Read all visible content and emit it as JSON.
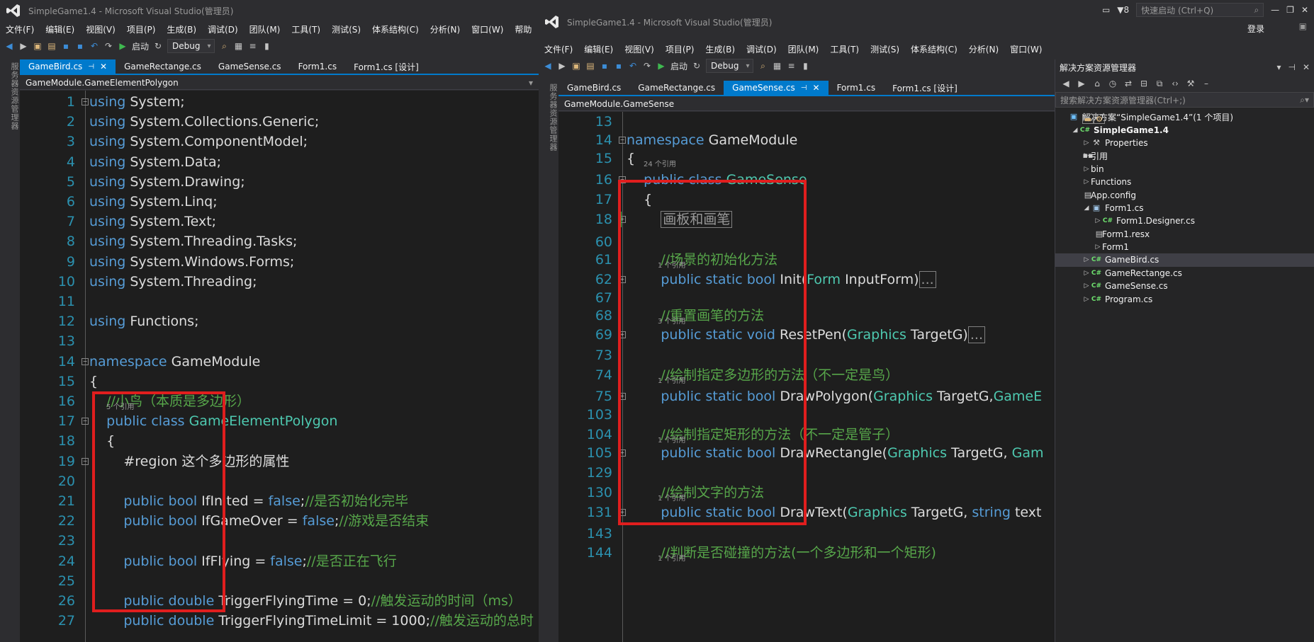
{
  "left": {
    "title": "SimpleGame1.4 - Microsoft Visual Studio(管理员)",
    "menu": [
      "文件(F)",
      "编辑(E)",
      "视图(V)",
      "项目(P)",
      "生成(B)",
      "调试(D)",
      "团队(M)",
      "工具(T)",
      "测试(S)",
      "体系结构(C)",
      "分析(N)",
      "窗口(W)",
      "帮助"
    ],
    "toolbar": {
      "start": "启动",
      "config": "Debug"
    },
    "side_label": "服务器资源管理器",
    "tabs": [
      {
        "label": "GameBird.cs",
        "active": true
      },
      {
        "label": "GameRectange.cs"
      },
      {
        "label": "GameSense.cs"
      },
      {
        "label": "Form1.cs"
      },
      {
        "label": "Form1.cs [设计]"
      }
    ],
    "nav": "GameModule.GameElementPolygon",
    "lines": [
      {
        "n": "1",
        "parts": [
          [
            "kw",
            "using"
          ],
          [
            "tx",
            " System;"
          ]
        ]
      },
      {
        "n": "2",
        "parts": [
          [
            "kw",
            "using"
          ],
          [
            "tx",
            " System.Collections.Generic;"
          ]
        ]
      },
      {
        "n": "3",
        "parts": [
          [
            "kw",
            "using"
          ],
          [
            "tx",
            " System.ComponentModel;"
          ]
        ]
      },
      {
        "n": "4",
        "parts": [
          [
            "kw",
            "using"
          ],
          [
            "tx",
            " System.Data;"
          ]
        ]
      },
      {
        "n": "5",
        "parts": [
          [
            "kw",
            "using"
          ],
          [
            "tx",
            " System.Drawing;"
          ]
        ]
      },
      {
        "n": "6",
        "parts": [
          [
            "kw",
            "using"
          ],
          [
            "tx",
            " System.Linq;"
          ]
        ]
      },
      {
        "n": "7",
        "parts": [
          [
            "kw",
            "using"
          ],
          [
            "tx",
            " System.Text;"
          ]
        ]
      },
      {
        "n": "8",
        "parts": [
          [
            "kw",
            "using"
          ],
          [
            "tx",
            " System.Threading.Tasks;"
          ]
        ]
      },
      {
        "n": "9",
        "parts": [
          [
            "kw",
            "using"
          ],
          [
            "tx",
            " System.Windows.Forms;"
          ]
        ]
      },
      {
        "n": "10",
        "parts": [
          [
            "kw",
            "using"
          ],
          [
            "tx",
            " System.Threading;"
          ]
        ]
      },
      {
        "n": "11",
        "parts": []
      },
      {
        "n": "12",
        "parts": [
          [
            "kw",
            "using"
          ],
          [
            "tx",
            " Functions;"
          ]
        ]
      },
      {
        "n": "13",
        "parts": []
      },
      {
        "n": "14",
        "parts": [
          [
            "kw",
            "namespace"
          ],
          [
            "tx",
            " GameModule"
          ]
        ]
      },
      {
        "n": "15",
        "parts": [
          [
            "tx",
            "{"
          ]
        ]
      },
      {
        "n": "16",
        "parts": [
          [
            "cm",
            "    //小鸟（本质是多边形）"
          ]
        ]
      },
      {
        "n": "17",
        "parts": [
          [
            "kw",
            "    public class "
          ],
          [
            "ty",
            "GameElementPolygon"
          ]
        ]
      },
      {
        "n": "18",
        "parts": [
          [
            "tx",
            "    {"
          ]
        ]
      },
      {
        "n": "19",
        "parts": [
          [
            "tx",
            "        #region 这个多边形的属性"
          ]
        ]
      },
      {
        "n": "20",
        "parts": []
      },
      {
        "n": "21",
        "parts": [
          [
            "kw",
            "        public bool"
          ],
          [
            "tx",
            " IfInited = "
          ],
          [
            "kw",
            "false"
          ],
          [
            "tx",
            ";"
          ],
          [
            "cm",
            "//是否初始化完毕"
          ]
        ]
      },
      {
        "n": "22",
        "parts": [
          [
            "kw",
            "        public bool"
          ],
          [
            "tx",
            " IfGameOver = "
          ],
          [
            "kw",
            "false"
          ],
          [
            "tx",
            ";"
          ],
          [
            "cm",
            "//游戏是否结束"
          ]
        ]
      },
      {
        "n": "23",
        "parts": []
      },
      {
        "n": "24",
        "parts": [
          [
            "kw",
            "        public bool"
          ],
          [
            "tx",
            " IfFlying = "
          ],
          [
            "kw",
            "false"
          ],
          [
            "tx",
            ";"
          ],
          [
            "cm",
            "//是否正在飞行"
          ]
        ]
      },
      {
        "n": "25",
        "parts": []
      },
      {
        "n": "26",
        "parts": [
          [
            "kw",
            "        public double"
          ],
          [
            "tx",
            " TriggerFlyingTime = 0;"
          ],
          [
            "cm",
            "//触发运动的时间（ms）"
          ]
        ]
      },
      {
        "n": "27",
        "parts": [
          [
            "kw",
            "        public double"
          ],
          [
            "tx",
            " TriggerFlyingTimeLimit = 1000;"
          ],
          [
            "cm",
            "//触发运动的总时"
          ]
        ]
      }
    ],
    "ref_line17": "5 个引用"
  },
  "right": {
    "title": "SimpleGame1.4 - Microsoft Visual Studio(管理员)",
    "notify_count": "8",
    "quick_launch": "快速启动 (Ctrl+Q)",
    "login": "登录",
    "menu": [
      "文件(F)",
      "编辑(E)",
      "视图(V)",
      "项目(P)",
      "生成(B)",
      "调试(D)",
      "团队(M)",
      "工具(T)",
      "测试(S)",
      "体系结构(C)",
      "分析(N)",
      "窗口(W)"
    ],
    "toolbar": {
      "start": "启动",
      "config": "Debug"
    },
    "side_label": "服务器资源管理器",
    "tabs": [
      {
        "label": "GameBird.cs"
      },
      {
        "label": "GameRectange.cs"
      },
      {
        "label": "GameSense.cs",
        "active": true
      },
      {
        "label": "Form1.cs"
      },
      {
        "label": "Form1.cs [设计]"
      }
    ],
    "nav": "GameModule.GameSense",
    "refs": {
      "r15": "24 个引用",
      "r61": "1 个引用",
      "r68": "3 个引用",
      "r74": "1 个引用",
      "r104": "1 个引用",
      "r130": "1 个引用",
      "r144": "1 个引用"
    },
    "lines": [
      {
        "n": "13",
        "parts": []
      },
      {
        "n": "14",
        "parts": [
          [
            "kw",
            "namespace"
          ],
          [
            "tx",
            " GameModule"
          ]
        ]
      },
      {
        "n": "15",
        "parts": [
          [
            "tx",
            "{"
          ]
        ]
      },
      {
        "n": "16",
        "parts": [
          [
            "kw",
            "    public class "
          ],
          [
            "ty",
            "GameSense"
          ]
        ]
      },
      {
        "n": "17",
        "parts": [
          [
            "tx",
            "    {"
          ]
        ]
      },
      {
        "n": "18",
        "parts": [
          [
            "tx",
            "        "
          ],
          [
            "box",
            "画板和画笔"
          ]
        ]
      },
      {
        "n": "60",
        "parts": []
      },
      {
        "n": "61",
        "parts": [
          [
            "cm",
            "        //场景的初始化方法"
          ]
        ]
      },
      {
        "n": "62",
        "parts": [
          [
            "kw",
            "        public static bool"
          ],
          [
            "tx",
            " Init("
          ],
          [
            "ty",
            "Form"
          ],
          [
            "tx",
            " InputForm)"
          ],
          [
            "box",
            "..."
          ]
        ]
      },
      {
        "n": "67",
        "parts": []
      },
      {
        "n": "68",
        "parts": [
          [
            "cm",
            "        //重置画笔的方法"
          ]
        ]
      },
      {
        "n": "69",
        "parts": [
          [
            "kw",
            "        public static void"
          ],
          [
            "tx",
            " ResetPen("
          ],
          [
            "ty",
            "Graphics"
          ],
          [
            "tx",
            " TargetG)"
          ],
          [
            "box",
            "..."
          ]
        ]
      },
      {
        "n": "73",
        "parts": []
      },
      {
        "n": "74",
        "parts": [
          [
            "cm",
            "        //绘制指定多边形的方法（不一定是鸟）"
          ]
        ]
      },
      {
        "n": "75",
        "parts": [
          [
            "kw",
            "        public static bool"
          ],
          [
            "tx",
            " DrawPolygon("
          ],
          [
            "ty",
            "Graphics"
          ],
          [
            "tx",
            " TargetG,"
          ],
          [
            "ty",
            "GameE"
          ]
        ]
      },
      {
        "n": "103",
        "parts": []
      },
      {
        "n": "104",
        "parts": [
          [
            "cm",
            "        //绘制指定矩形的方法（不一定是管子）"
          ]
        ]
      },
      {
        "n": "105",
        "parts": [
          [
            "kw",
            "        public static bool"
          ],
          [
            "tx",
            " DrawRectangle("
          ],
          [
            "ty",
            "Graphics"
          ],
          [
            "tx",
            " TargetG, "
          ],
          [
            "ty",
            "Gam"
          ]
        ]
      },
      {
        "n": "129",
        "parts": []
      },
      {
        "n": "130",
        "parts": [
          [
            "cm",
            "        //绘制文字的方法"
          ]
        ]
      },
      {
        "n": "131",
        "parts": [
          [
            "kw",
            "        public static bool"
          ],
          [
            "tx",
            " DrawText("
          ],
          [
            "ty",
            "Graphics"
          ],
          [
            "tx",
            " TargetG, "
          ],
          [
            "kw",
            "string"
          ],
          [
            "tx",
            " text"
          ]
        ]
      },
      {
        "n": "143",
        "parts": []
      },
      {
        "n": "144",
        "parts": [
          [
            "cm",
            "        //判断是否碰撞的方法(一个多边形和一个矩形)"
          ]
        ]
      }
    ]
  },
  "solution_explorer": {
    "title": "解决方案资源管理器",
    "search_placeholder": "搜索解决方案资源管理器(Ctrl+;)",
    "nodes": [
      {
        "label": "解决方案“SimpleGame1.4”(1 个项目)",
        "icon": "solution-icon",
        "arrow": "",
        "indent": 0
      },
      {
        "label": "SimpleGame1.4",
        "icon": "csharp-project-icon",
        "arrow": "◢",
        "indent": 1,
        "bold": true
      },
      {
        "label": "Properties",
        "icon": "wrench-icon",
        "arrow": "▷",
        "indent": 2
      },
      {
        "label": "引用",
        "icon": "references-icon",
        "arrow": "▷",
        "indent": 2
      },
      {
        "label": "bin",
        "icon": "folder-icon",
        "arrow": "▷",
        "indent": 2
      },
      {
        "label": "Functions",
        "icon": "folder-icon",
        "arrow": "▷",
        "indent": 2
      },
      {
        "label": "App.config",
        "icon": "config-icon",
        "arrow": "",
        "indent": 2
      },
      {
        "label": "Form1.cs",
        "icon": "form-icon",
        "arrow": "◢",
        "indent": 2
      },
      {
        "label": "Form1.Designer.cs",
        "icon": "csharp-file-icon",
        "arrow": "▷",
        "indent": 3
      },
      {
        "label": "Form1.resx",
        "icon": "resx-icon",
        "arrow": "",
        "indent": 3
      },
      {
        "label": "Form1",
        "icon": "form-class-icon",
        "arrow": "▷",
        "indent": 3
      },
      {
        "label": "GameBird.cs",
        "icon": "csharp-file-icon",
        "arrow": "▷",
        "indent": 2,
        "selected": true
      },
      {
        "label": "GameRectange.cs",
        "icon": "csharp-file-icon",
        "arrow": "▷",
        "indent": 2
      },
      {
        "label": "GameSense.cs",
        "icon": "csharp-file-icon",
        "arrow": "▷",
        "indent": 2
      },
      {
        "label": "Program.cs",
        "icon": "csharp-file-icon",
        "arrow": "▷",
        "indent": 2
      }
    ]
  },
  "colors": {
    "accent": "#007acc",
    "highlight_box": "#e01e1e",
    "keyword": "#569cd6",
    "type": "#4ec9b0",
    "comment": "#57a64a",
    "line_number": "#2b91af"
  }
}
